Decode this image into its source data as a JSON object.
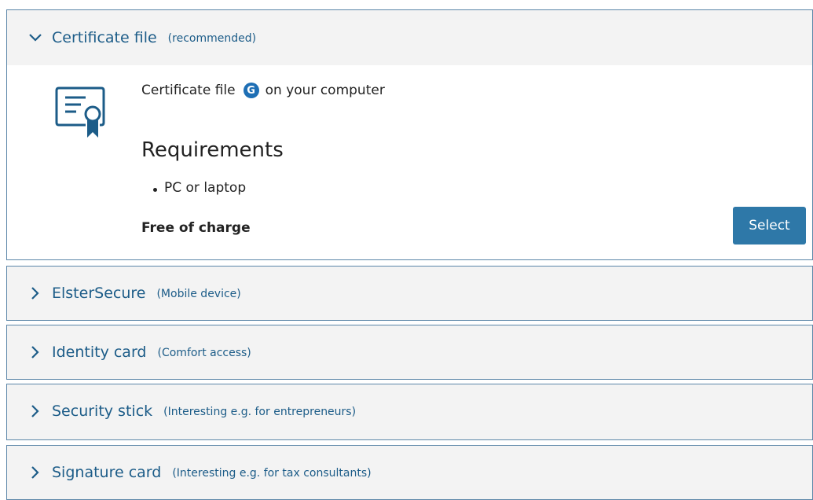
{
  "panels": [
    {
      "title": "Certificate file",
      "subtitle": "(recommended)",
      "expanded": true,
      "body": {
        "intro_before": "Certificate file",
        "badge": "G",
        "intro_after": "on your computer",
        "requirements_title": "Requirements",
        "requirements": [
          "PC or laptop"
        ],
        "price": "Free of charge",
        "button": "Select"
      }
    },
    {
      "title": "ElsterSecure",
      "subtitle": "(Mobile device)",
      "expanded": false
    },
    {
      "title": "Identity card",
      "subtitle": "(Comfort access)",
      "expanded": false
    },
    {
      "title": "Security stick",
      "subtitle": "(Interesting e.g. for entrepreneurs)",
      "expanded": false
    },
    {
      "title": "Signature card",
      "subtitle": "(Interesting e.g. for tax consultants)",
      "expanded": false
    }
  ],
  "colors": {
    "accent": "#1c5c88",
    "button": "#2e78a8",
    "border": "#5b86a8",
    "header_bg": "#f3f3f3"
  },
  "icons": {
    "expanded": "chevron-down-icon",
    "collapsed": "chevron-right-icon",
    "certificate": "certificate-icon",
    "badge": "info-g-badge-icon"
  }
}
